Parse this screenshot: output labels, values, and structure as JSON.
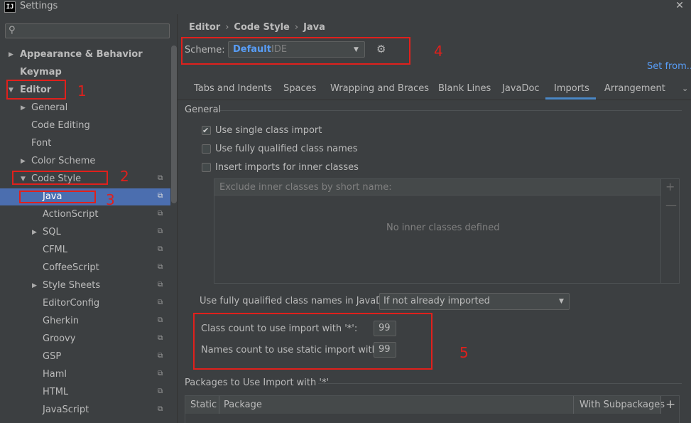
{
  "window": {
    "title": "Settings",
    "logo_text": "IJ",
    "close_glyph": "✕"
  },
  "sidebar": {
    "search": {
      "placeholder": ""
    },
    "items": [
      {
        "label": "Appearance & Behavior",
        "arrow": "▶"
      },
      {
        "label": "Keymap"
      },
      {
        "label": "Editor",
        "arrow": "▼"
      },
      {
        "label": "General",
        "arrow": "▶"
      },
      {
        "label": "Code Editing"
      },
      {
        "label": "Font"
      },
      {
        "label": "Color Scheme",
        "arrow": "▶"
      },
      {
        "label": "Code Style",
        "arrow": "▼"
      },
      {
        "label": "Java",
        "selected": true
      },
      {
        "label": "ActionScript"
      },
      {
        "label": "SQL",
        "arrow": "▶"
      },
      {
        "label": "CFML"
      },
      {
        "label": "CoffeeScript"
      },
      {
        "label": "Style Sheets",
        "arrow": "▶"
      },
      {
        "label": "EditorConfig"
      },
      {
        "label": "Gherkin"
      },
      {
        "label": "Groovy"
      },
      {
        "label": "GSP"
      },
      {
        "label": "Haml"
      },
      {
        "label": "HTML"
      },
      {
        "label": "JavaScript"
      }
    ]
  },
  "breadcrumb": [
    "Editor",
    "Code Style",
    "Java"
  ],
  "breadcrumb_separator": "›",
  "scheme": {
    "label": "Scheme:",
    "name": "Default",
    "type": "IDE",
    "chevron": "▼",
    "gear_glyph": "⚙"
  },
  "set_from": "Set from...",
  "tabs": [
    {
      "label": "Tabs and Indents"
    },
    {
      "label": "Spaces"
    },
    {
      "label": "Wrapping and Braces"
    },
    {
      "label": "Blank Lines"
    },
    {
      "label": "JavaDoc"
    },
    {
      "label": "Imports",
      "active": true
    },
    {
      "label": "Arrangement"
    }
  ],
  "tab_more": "⌄",
  "general": {
    "title": "General",
    "checkboxes": [
      {
        "label": "Use single class import",
        "checked": true
      },
      {
        "label": "Use fully qualified class names",
        "checked": false
      },
      {
        "label": "Insert imports for inner classes",
        "checked": false
      }
    ],
    "check_glyph": "✔",
    "inner_list_header": "Exclude inner classes by short name:",
    "inner_list_empty": "No inner classes defined",
    "add_glyph": "+",
    "remove_glyph": "—"
  },
  "javadoc": {
    "label": "Use fully qualified class names in JavaDoc:",
    "value": "If not already imported"
  },
  "counts": {
    "class_label": "Class count to use import with '*':",
    "class_value": "99",
    "names_label": "Names count to use static import with '*':",
    "names_value": "99"
  },
  "packages": {
    "title": "Packages to Use Import with '*'",
    "columns": [
      "Static",
      "Package",
      "With Subpackages"
    ],
    "add_glyph": "+"
  },
  "annotations": [
    "1",
    "2",
    "3",
    "4",
    "5"
  ],
  "colors": {
    "background": "#3c3f41",
    "selection": "#4b6eaf",
    "accent_link": "#589df6",
    "annotation_red": "#e0201c"
  }
}
